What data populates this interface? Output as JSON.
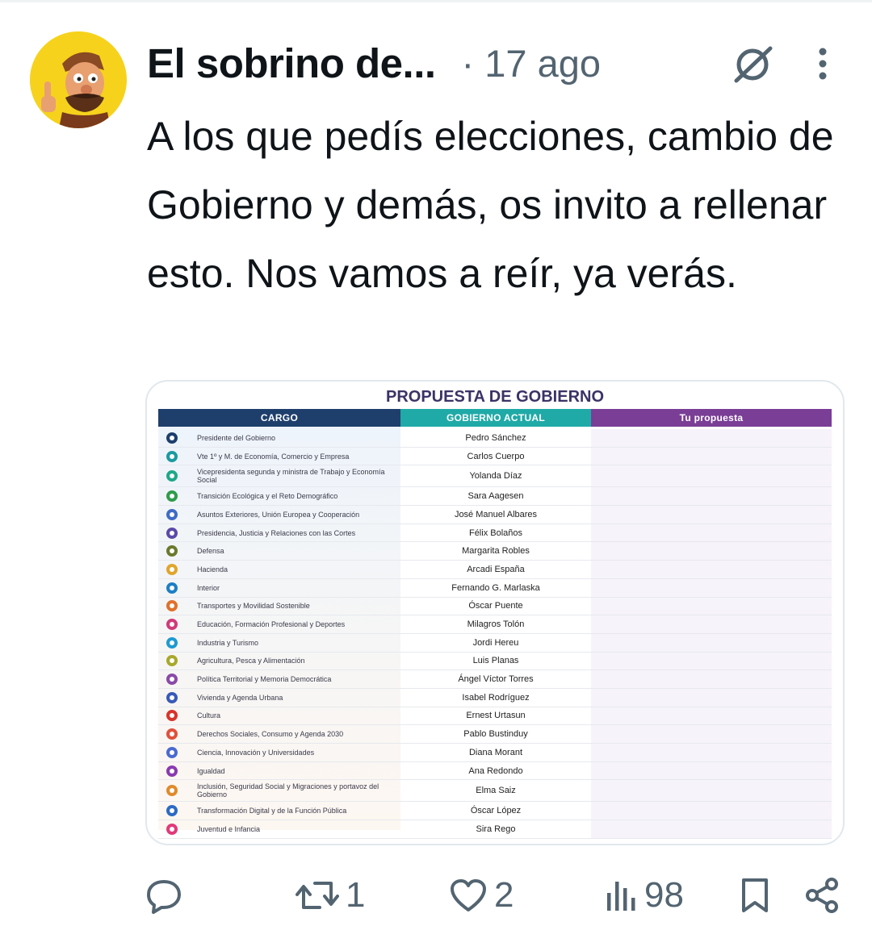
{
  "tweet": {
    "author_name": "El sobrino de...",
    "time": "· 17 ago",
    "text": "A los que pedís elecciones, cambio de Gobierno y demás, os invito a rellenar esto. Nos vamos a reír, ya verás."
  },
  "image": {
    "title": "PROPUESTA DE GOBIERNO",
    "headers": {
      "cargo": "CARGO",
      "actual": "GOBIERNO ACTUAL",
      "tu": "Tu propuesta"
    },
    "rows": [
      {
        "cargo": "Presidente del Gobierno",
        "actual": "Pedro Sánchez",
        "color": "#1e3f6c"
      },
      {
        "cargo": "Vte 1º y M. de Economía, Comercio y Empresa",
        "actual": "Carlos Cuerpo",
        "color": "#1b9aa0"
      },
      {
        "cargo": "Vicepresidenta segunda y ministra de Trabajo y Economía Social",
        "actual": "Yolanda Díaz",
        "color": "#1fa88a"
      },
      {
        "cargo": "Transición Ecológica y el Reto Demográfico",
        "actual": "Sara Aagesen",
        "color": "#2e9c4a"
      },
      {
        "cargo": "Asuntos Exteriores, Unión Europea y Cooperación",
        "actual": "José Manuel Albares",
        "color": "#3f6cc4"
      },
      {
        "cargo": "Presidencia, Justicia y Relaciones con las Cortes",
        "actual": "Félix Bolaños",
        "color": "#5b4aa8"
      },
      {
        "cargo": "Defensa",
        "actual": "Margarita Robles",
        "color": "#6a7a2c"
      },
      {
        "cargo": "Hacienda",
        "actual": "Arcadi España",
        "color": "#e0a52c"
      },
      {
        "cargo": "Interior",
        "actual": "Fernando G. Marlaska",
        "color": "#1e7fc4"
      },
      {
        "cargo": "Transportes y Movilidad Sostenible",
        "actual": "Óscar Puente",
        "color": "#e0702c"
      },
      {
        "cargo": "Educación, Formación Profesional y Deportes",
        "actual": "Milagros Tolón",
        "color": "#d13a7a"
      },
      {
        "cargo": "Industria y Turismo",
        "actual": "Jordi Hereu",
        "color": "#1e9ad0"
      },
      {
        "cargo": "Agricultura, Pesca y Alimentación",
        "actual": "Luis Planas",
        "color": "#a8a82c"
      },
      {
        "cargo": "Política Territorial y Memoria Democrática",
        "actual": "Ángel Víctor Torres",
        "color": "#8a4aa8"
      },
      {
        "cargo": "Vivienda y Agenda Urbana",
        "actual": "Isabel Rodríguez",
        "color": "#3a5ab8"
      },
      {
        "cargo": "Cultura",
        "actual": "Ernest Urtasun",
        "color": "#d8342c"
      },
      {
        "cargo": "Derechos Sociales, Consumo y Agenda 2030",
        "actual": "Pablo Bustinduy",
        "color": "#e0503c"
      },
      {
        "cargo": "Ciencia, Innovación y Universidades",
        "actual": "Diana Morant",
        "color": "#4a6ad0"
      },
      {
        "cargo": "Igualdad",
        "actual": "Ana Redondo",
        "color": "#8a3ab0"
      },
      {
        "cargo": "Inclusión, Seguridad Social y Migraciones y portavoz del Gobierno",
        "actual": "Elma Saiz",
        "color": "#e08a2c"
      },
      {
        "cargo": "Transformación Digital y de la Función Pública",
        "actual": "Óscar López",
        "color": "#2c6ac4"
      },
      {
        "cargo": "Juventud e Infancia",
        "actual": "Sira Rego",
        "color": "#e03a7a"
      }
    ]
  },
  "actions": {
    "replies": "",
    "retweets": "1",
    "likes": "2",
    "views": "98"
  },
  "icons": {
    "grok": "grok-icon",
    "more": "more-dots-icon",
    "reply": "reply-icon",
    "retweet": "retweet-icon",
    "like": "heart-icon",
    "views": "views-icon",
    "bookmark": "bookmark-icon",
    "share": "share-icon"
  }
}
